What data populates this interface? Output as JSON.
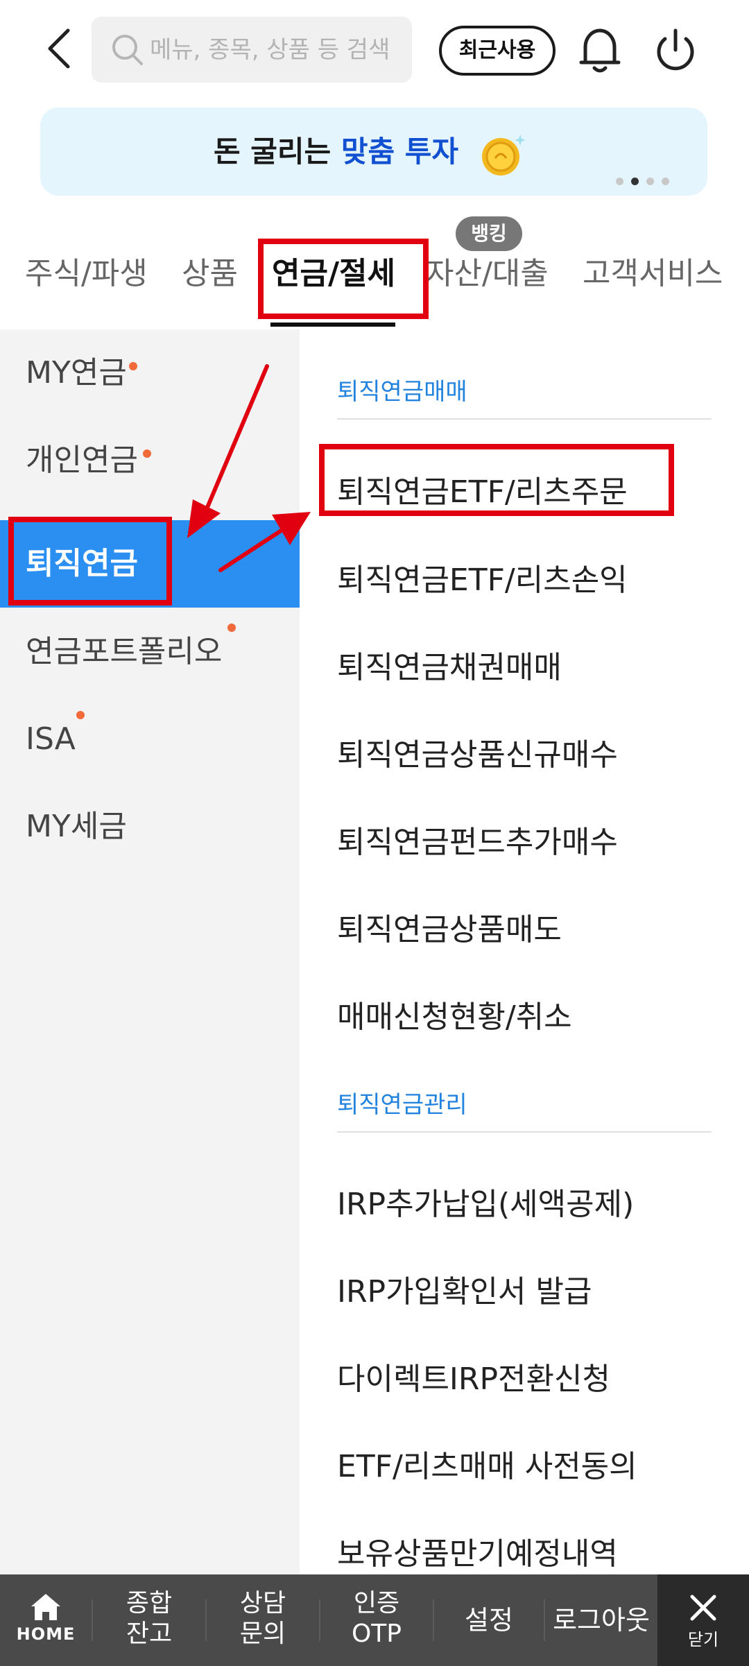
{
  "header": {
    "search_placeholder": "메뉴, 종목, 상품 등 검색",
    "recent_label": "최근사용",
    "icons": [
      "chevron-left-icon",
      "search-icon",
      "bell-icon",
      "power-icon"
    ]
  },
  "banner": {
    "text_prefix": "돈 굴리는 ",
    "text_highlight": "맞춤 투자",
    "page_count": 4,
    "active_page": 2
  },
  "tabs": {
    "items": [
      "주식/파생",
      "상품",
      "연금/절세",
      "자산/대출",
      "고객서비스"
    ],
    "active_index": 2,
    "badge": "뱅킹"
  },
  "left_menu": {
    "items": [
      {
        "label": "MY연금",
        "new": true
      },
      {
        "label": "개인연금",
        "new": true
      },
      {
        "label": "퇴직연금",
        "new": false,
        "active": true
      },
      {
        "label": "연금포트폴리오",
        "new": true
      },
      {
        "label": "ISA",
        "new": true
      },
      {
        "label": "MY세금",
        "new": false
      }
    ]
  },
  "right_menu": {
    "sections": [
      {
        "title": "퇴직연금매매",
        "items": [
          "퇴직연금ETF/리츠주문",
          "퇴직연금ETF/리츠손익",
          "퇴직연금채권매매",
          "퇴직연금상품신규매수",
          "퇴직연금펀드추가매수",
          "퇴직연금상품매도",
          "매매신청현황/취소"
        ]
      },
      {
        "title": "퇴직연금관리",
        "items": [
          "IRP추가납입(세액공제)",
          "IRP가입확인서 발급",
          "다이렉트IRP전환신청",
          "ETF/리츠매매 사전동의",
          "보유상품만기예정내역"
        ]
      }
    ]
  },
  "bottom_bar": {
    "home": "HOME",
    "balance_line1": "종합",
    "balance_line2": "잔고",
    "consult_line1": "상담",
    "consult_line2": "문의",
    "otp_line1": "인증",
    "otp_line2": "OTP",
    "settings": "설정",
    "logout": "로그아웃",
    "close": "닫기"
  },
  "colors": {
    "accent_blue": "#2b8ff2",
    "section_blue": "#2283de",
    "highlight_red": "#e0000f",
    "new_dot": "#f26a3a",
    "bottom_bar": "#4a4a4a"
  }
}
